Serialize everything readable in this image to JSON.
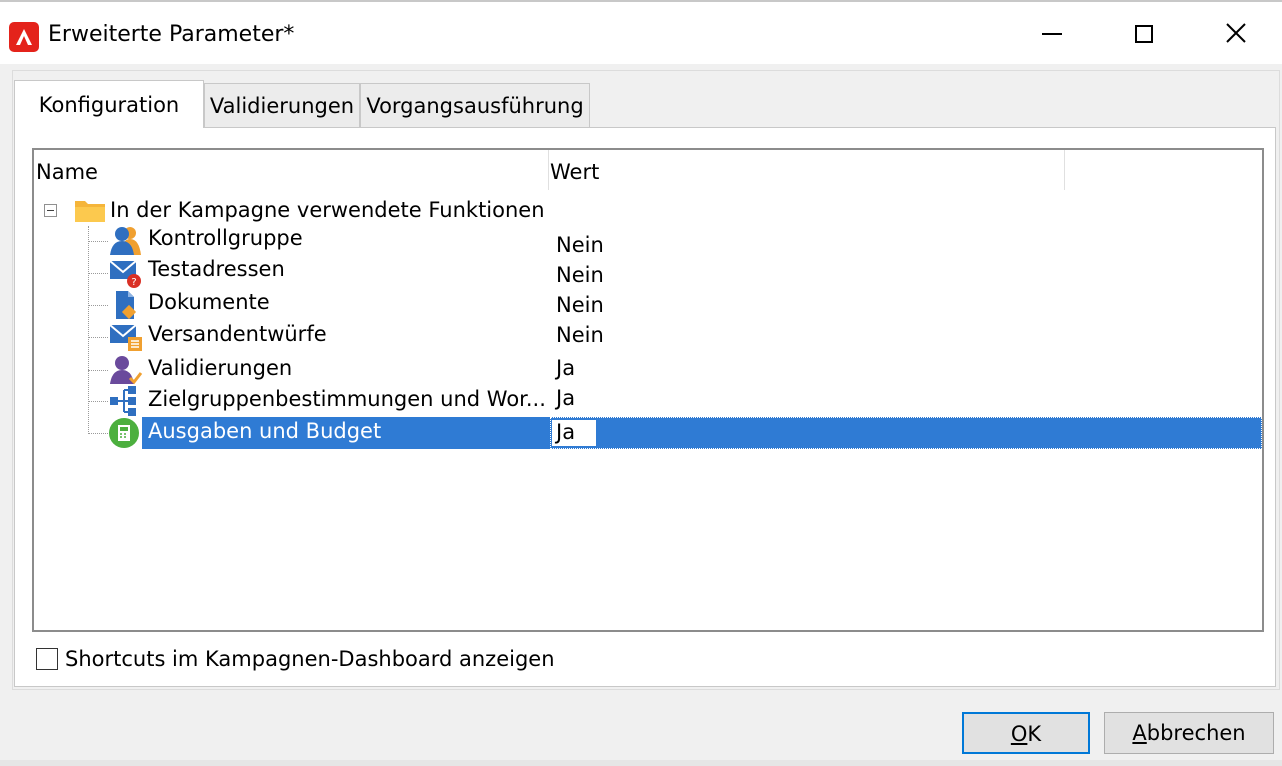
{
  "window": {
    "title": "Erweiterte Parameter*",
    "controls": [
      "minimize",
      "maximize",
      "close"
    ]
  },
  "tabs": [
    {
      "label": "Konfiguration",
      "active": true
    },
    {
      "label": "Validierungen",
      "active": false
    },
    {
      "label": "Vorgangsausführung",
      "active": false
    }
  ],
  "grid": {
    "columns": {
      "name": "Name",
      "value": "Wert"
    },
    "folder": {
      "label": "In der Kampagne verwendete Funktionen",
      "expanded": true,
      "icon": "folder-icon"
    },
    "rows": [
      {
        "label": "Kontrollgruppe",
        "value": "Nein",
        "icon": "control-group-icon"
      },
      {
        "label": "Testadressen",
        "value": "Nein",
        "icon": "test-address-icon"
      },
      {
        "label": "Dokumente",
        "value": "Nein",
        "icon": "documents-icon"
      },
      {
        "label": "Versandentwürfe",
        "value": "Nein",
        "icon": "delivery-templates-icon"
      },
      {
        "label": "Validierungen",
        "value": "Ja",
        "icon": "validations-icon"
      },
      {
        "label": "Zielgruppenbestimmungen und Wor...",
        "value": "Ja",
        "icon": "targeting-workflow-icon"
      },
      {
        "label": "Ausgaben und Budget",
        "value": "Ja",
        "icon": "budget-icon",
        "selected": true
      }
    ]
  },
  "checkbox": {
    "label": "Shortcuts im Kampagnen-Dashboard anzeigen",
    "checked": false
  },
  "buttons": {
    "ok": {
      "mnemonic": "O",
      "rest": "K"
    },
    "cancel": {
      "mnemonic": "A",
      "rest": "bbrechen"
    }
  },
  "colors": {
    "selection": "#2f7bd4",
    "brand": "#e4231b",
    "ok_border": "#0078d7"
  }
}
